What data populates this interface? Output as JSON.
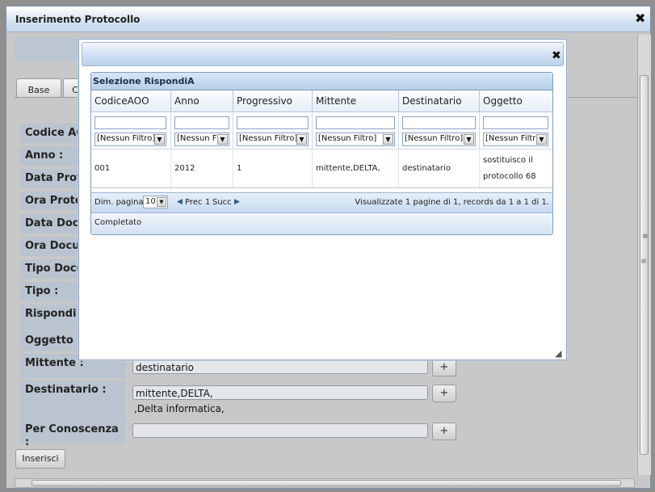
{
  "window": {
    "title": "Inserimento Protocollo",
    "close_glyph": "✖"
  },
  "tabs": [
    {
      "label": "Base"
    },
    {
      "label": "C"
    }
  ],
  "form": {
    "labels": [
      "Codice AOO",
      "Anno :",
      "Data Proto",
      "Ora Proto",
      "Data Docu",
      "Ora Docu",
      "Tipo Docu",
      "Tipo :",
      "Rispondi a",
      "Oggetto :",
      "Mittente :",
      "Destinatario :",
      "Per Conoscenza :"
    ],
    "mittente_value": "destinatario",
    "destinatario_value": "mittente,DELTA,",
    "destinatario_extra": ",Delta informatica,",
    "per_conoscenza_value": "",
    "plus_label": "+",
    "submit_label": "Inserisci"
  },
  "dialog": {
    "close_glyph": "✖",
    "resize_glyph": "◢",
    "grid": {
      "caption": "Selezione RispondiA",
      "columns": [
        "CodiceAOO",
        "Anno",
        "Progressivo",
        "Mittente",
        "Destinatario",
        "Oggetto"
      ],
      "filter_option": "[Nessun Filtro]",
      "filter_option_short": "[Nessun F",
      "filter_option_clip": "[Nessun Filtr",
      "rows": [
        {
          "codice_aoo": "001",
          "anno": "2012",
          "progressivo": "1",
          "mittente": "mittente,DELTA,",
          "destinatario": "destinatario",
          "oggetto": "sostituisco il protocollo 68"
        }
      ],
      "pager": {
        "page_size_label": "Dim. pagina:",
        "page_size_value": "10",
        "prev_label": "Prec",
        "page_number": "1",
        "next_label": "Succ",
        "summary": "Visualizzate 1 pagine di 1, records da 1 a 1 di 1."
      },
      "status": "Completato"
    }
  },
  "scrollbar_grip": "≡"
}
